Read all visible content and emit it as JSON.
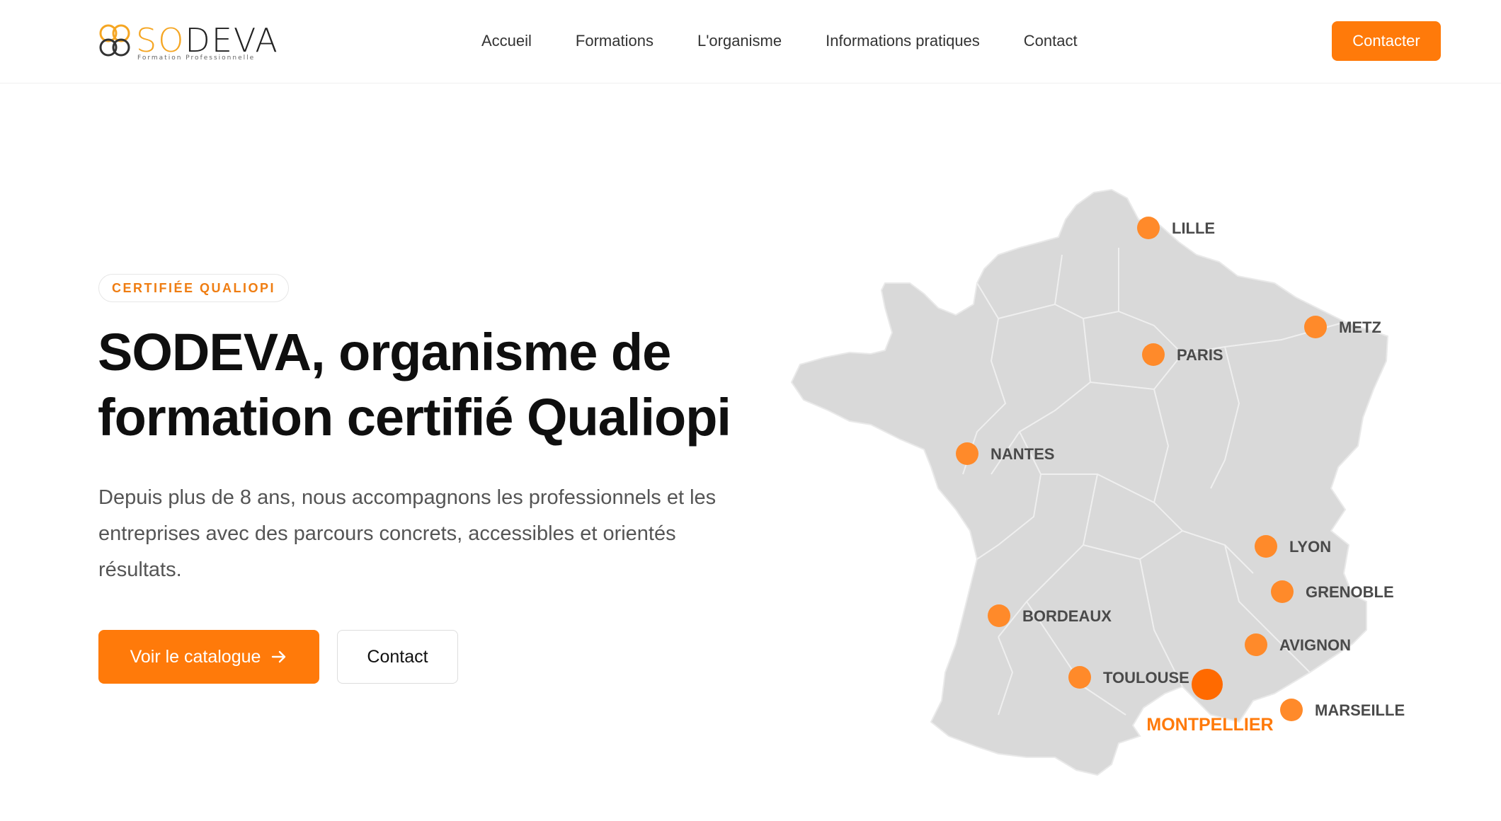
{
  "brand": {
    "name_accent": "SO",
    "name_rest": "DEVA",
    "tagline": "Formation Professionnelle",
    "accent_color": "#ff7a0a",
    "logo_color": "#f5a623"
  },
  "nav": {
    "items": [
      {
        "label": "Accueil"
      },
      {
        "label": "Formations"
      },
      {
        "label": "L'organisme"
      },
      {
        "label": "Informations pratiques"
      },
      {
        "label": "Contact"
      }
    ],
    "cta_label": "Contacter"
  },
  "hero": {
    "badge": "CERTIFIÉE QUALIOPI",
    "title_line1": "SODEVA, organisme de",
    "title_line2": "formation certifié Qualiopi",
    "description": "Depuis plus de 8 ans, nous accompagnons les professionnels et les entreprises avec des parcours concrets, accessibles et orientés résultats.",
    "primary_button": "Voir le catalogue",
    "primary_icon": "arrow-right-icon",
    "secondary_button": "Contact"
  },
  "map": {
    "cities": [
      {
        "name": "LILLE"
      },
      {
        "name": "METZ"
      },
      {
        "name": "PARIS"
      },
      {
        "name": "NANTES"
      },
      {
        "name": "LYON"
      },
      {
        "name": "GRENOBLE"
      },
      {
        "name": "BORDEAUX"
      },
      {
        "name": "AVIGNON"
      },
      {
        "name": "TOULOUSE"
      },
      {
        "name": "MONTPELLIER"
      },
      {
        "name": "MARSEILLE"
      }
    ],
    "highlighted_city": "MONTPELLIER",
    "marker_color": "#ff8a2a",
    "highlight_color": "#ff6a00",
    "land_color": "#d9d9d9"
  }
}
